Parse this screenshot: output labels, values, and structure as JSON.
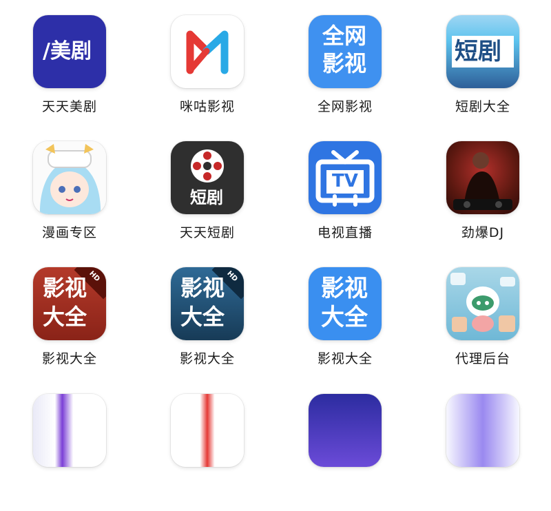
{
  "apps": [
    {
      "label": "天天美剧",
      "glyph": "/美剧",
      "color": "#2d2fa8"
    },
    {
      "label": "咪咕影视",
      "glyph": "",
      "color": "#ffffff"
    },
    {
      "label": "全网影视",
      "glyph_line1": "全网",
      "glyph_line2": "影视",
      "color": "#3f91f0"
    },
    {
      "label": "短剧大全",
      "glyph": "短剧",
      "color": "#5dc3ee"
    },
    {
      "label": "漫画专区",
      "glyph": "",
      "color": "#fdfdfd"
    },
    {
      "label": "天天短剧",
      "glyph": "短剧",
      "color": "#2f2f2f"
    },
    {
      "label": "电视直播",
      "glyph": "TV",
      "color": "#2f75e2"
    },
    {
      "label": "劲爆DJ",
      "glyph": "",
      "color": "#5b1810"
    },
    {
      "label": "影视大全",
      "glyph_line1": "影视",
      "glyph_line2": "大全",
      "badge": "HD",
      "color": "#8a2318"
    },
    {
      "label": "影视大全",
      "glyph_line1": "影视",
      "glyph_line2": "大全",
      "badge": "HD",
      "color": "#1f4f74"
    },
    {
      "label": "影视大全",
      "glyph_line1": "影视",
      "glyph_line2": "大全",
      "color": "#3a8ff0"
    },
    {
      "label": "代理后台",
      "glyph": "",
      "color": "#6fb8d6"
    }
  ]
}
